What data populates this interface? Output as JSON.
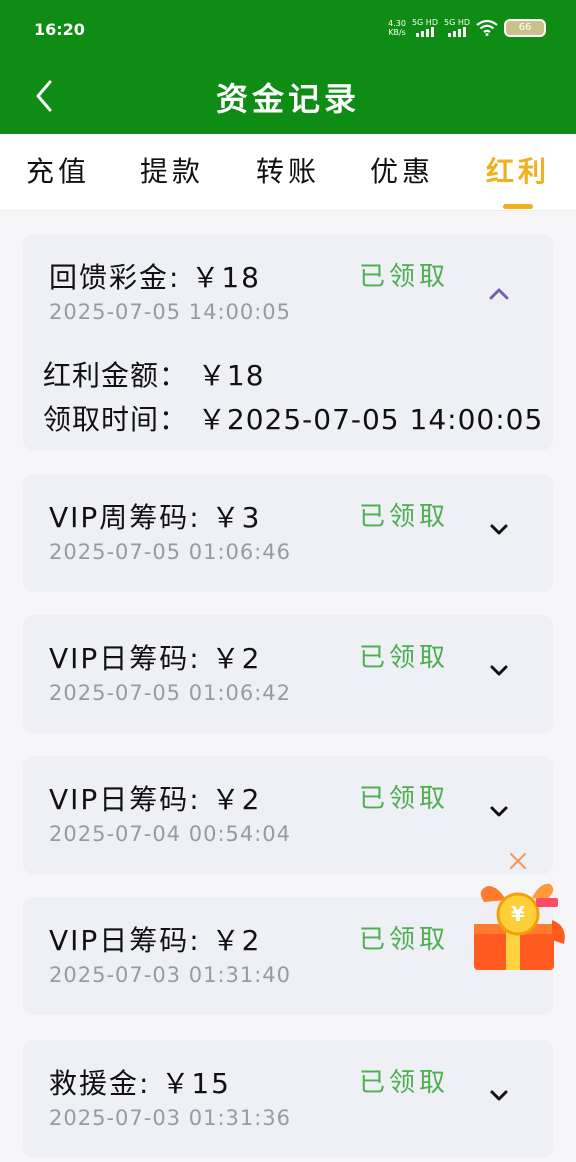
{
  "status_bar": {
    "time": "16:20",
    "net_speed_value": "4.30",
    "net_speed_unit": "KB/s",
    "sim1": "5G HD",
    "sim2": "5G HD",
    "battery": "66"
  },
  "header": {
    "title": "资金记录"
  },
  "tabs": [
    {
      "label": "充值"
    },
    {
      "label": "提款"
    },
    {
      "label": "转账"
    },
    {
      "label": "优惠"
    },
    {
      "label": "红利",
      "active": true
    }
  ],
  "records": [
    {
      "title": "回馈彩金: ￥18",
      "status": "已领取",
      "time": "2025-07-05 14:00:05",
      "expanded": true,
      "details": [
        {
          "text": "红利金额： ￥18"
        },
        {
          "text": "领取时间： ￥2025-07-05 14:00:05"
        }
      ]
    },
    {
      "title": "VIP周筹码: ￥3",
      "status": "已领取",
      "time": "2025-07-05 01:06:46",
      "expanded": false
    },
    {
      "title": "VIP日筹码: ￥2",
      "status": "已领取",
      "time": "2025-07-05 01:06:42",
      "expanded": false
    },
    {
      "title": "VIP日筹码: ￥2",
      "status": "已领取",
      "time": "2025-07-04 00:54:04",
      "expanded": false
    },
    {
      "title": "VIP日筹码: ￥2",
      "status": "已领取",
      "time": "2025-07-03 01:31:40",
      "expanded": false
    },
    {
      "title": "救援金: ￥15",
      "status": "已领取",
      "time": "2025-07-03 01:31:36",
      "expanded": false
    }
  ],
  "colors": {
    "header_green": "#0f8c14",
    "active_tab": "#f0b020",
    "status_green": "#4caf50",
    "time_gray": "#9a9aa4",
    "card_bg": "#eef0f5"
  },
  "icons": {
    "back": "chevron-left-icon",
    "collapse": "chevron-up-icon",
    "expand": "chevron-down-icon",
    "close": "close-icon",
    "gift": "gift-box-icon"
  }
}
